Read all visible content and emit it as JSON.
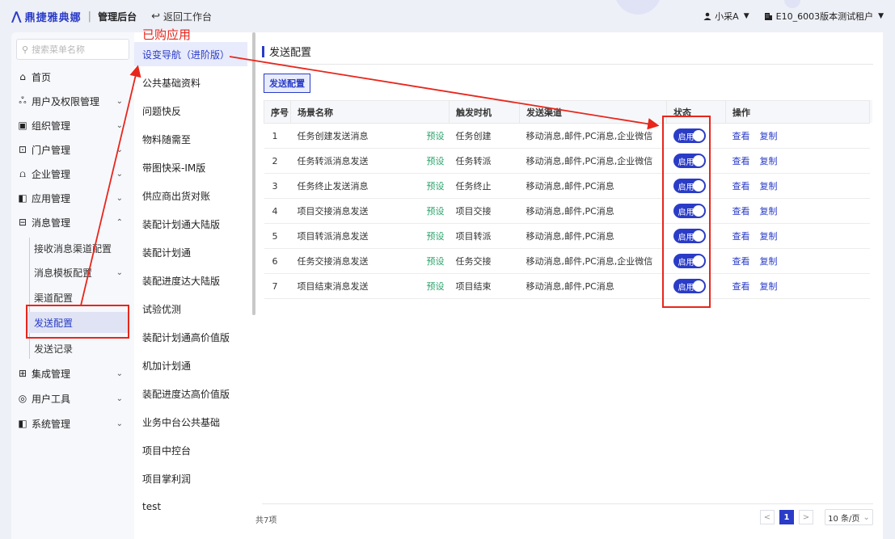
{
  "header": {
    "logo_glyph": "⋀",
    "brand": "鼎捷雅典娜",
    "separator": "|",
    "subtitle": "管理后台",
    "back_icon": "↩",
    "back_label": "返回工作台",
    "user_icon": "person-icon",
    "user": "小采A",
    "tenant_icon": "building-icon",
    "tenant": "E10_6003版本测试租户"
  },
  "sidebar": {
    "search_placeholder": "搜索菜单名称",
    "menu": [
      {
        "label": "首页",
        "icon": "home-icon",
        "glyph": "⌂"
      },
      {
        "label": "用户及权限管理",
        "icon": "users-icon",
        "glyph": "ஃ",
        "chevron": "⌄"
      },
      {
        "label": "组织管理",
        "icon": "org-icon",
        "glyph": "▣",
        "chevron": "⌄"
      },
      {
        "label": "门户管理",
        "icon": "portal-icon",
        "glyph": "⊡",
        "chevron": "⌄"
      },
      {
        "label": "企业管理",
        "icon": "enterprise-icon",
        "glyph": "⩍",
        "chevron": "⌄"
      },
      {
        "label": "应用管理",
        "icon": "app-icon",
        "glyph": "◧",
        "chevron": "⌄"
      },
      {
        "label": "消息管理",
        "icon": "message-icon",
        "glyph": "⊟",
        "chevron": "⌃"
      }
    ],
    "message_sub": [
      {
        "label": "接收消息渠道配置"
      },
      {
        "label": "消息模板配置",
        "chevron": "⌄"
      },
      {
        "label": "渠道配置"
      },
      {
        "label": "发送配置"
      },
      {
        "label": "发送记录"
      }
    ],
    "menu_bottom": [
      {
        "label": "集成管理",
        "icon": "integration-icon",
        "glyph": "⊞",
        "chevron": "⌄"
      },
      {
        "label": "用户工具",
        "icon": "tool-icon",
        "glyph": "◎",
        "chevron": "⌄"
      },
      {
        "label": "系统管理",
        "icon": "system-icon",
        "glyph": "◧",
        "chevron": "⌄"
      }
    ]
  },
  "apps": {
    "annotation": "已购应用",
    "items": [
      "设变导航（进阶版）",
      "公共基础资料",
      "问题快反",
      "物料随需至",
      "带图快采-IM版",
      "供应商出货对账",
      "装配计划通大陆版",
      "装配计划通",
      "装配进度达大陆版",
      "试验优测",
      "装配计划通高价值版",
      "机加计划通",
      "装配进度达高价值版",
      "业务中台公共基础",
      "项目中控台",
      "项目掌利润",
      "test"
    ]
  },
  "main": {
    "title": "发送配置",
    "tab": "发送配置",
    "columns": [
      "序号",
      "场景名称",
      "触发时机",
      "发送渠道",
      "状态",
      "操作"
    ],
    "rows": [
      {
        "idx": "1",
        "name": "任务创建发送消息",
        "tag": "预设",
        "trigger": "任务创建",
        "channel": "移动消息,邮件,PC消息,企业微信",
        "status": "启用"
      },
      {
        "idx": "2",
        "name": "任务转派消息发送",
        "tag": "预设",
        "trigger": "任务转派",
        "channel": "移动消息,邮件,PC消息,企业微信",
        "status": "启用"
      },
      {
        "idx": "3",
        "name": "任务终止发送消息",
        "tag": "预设",
        "trigger": "任务终止",
        "channel": "移动消息,邮件,PC消息",
        "status": "启用"
      },
      {
        "idx": "4",
        "name": "项目交接消息发送",
        "tag": "预设",
        "trigger": "项目交接",
        "channel": "移动消息,邮件,PC消息",
        "status": "启用"
      },
      {
        "idx": "5",
        "name": "项目转派消息发送",
        "tag": "预设",
        "trigger": "项目转派",
        "channel": "移动消息,邮件,PC消息",
        "status": "启用"
      },
      {
        "idx": "6",
        "name": "任务交接消息发送",
        "tag": "预设",
        "trigger": "任务交接",
        "channel": "移动消息,邮件,PC消息,企业微信",
        "status": "启用"
      },
      {
        "idx": "7",
        "name": "项目结束消息发送",
        "tag": "预设",
        "trigger": "项目结束",
        "channel": "移动消息,邮件,PC消息",
        "status": "启用"
      }
    ],
    "actions": [
      "查看",
      "复制"
    ],
    "total": "共7项",
    "pager": {
      "prev": "<",
      "current": "1",
      "next": ">",
      "page_size": "10 条/页",
      "size_caret": "⌄"
    }
  },
  "colors": {
    "accent": "#2a3cc7",
    "annotation": "#e8261c",
    "preset_tag": "#2ba36b"
  }
}
